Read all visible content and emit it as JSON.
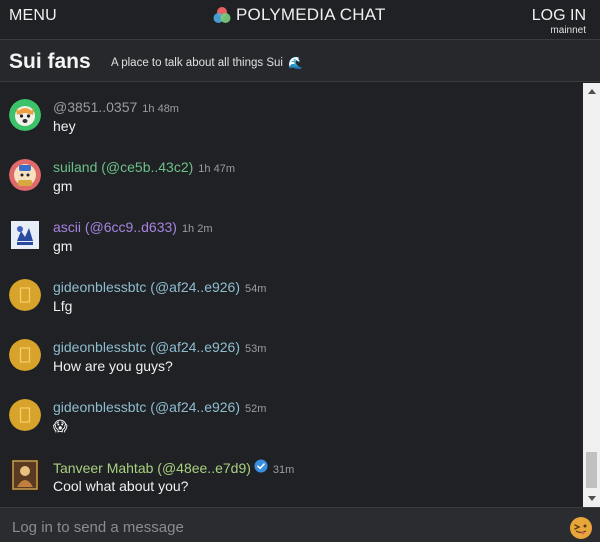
{
  "header": {
    "menu_label": "MENU",
    "app_title": "POLYMEDIA CHAT",
    "login_label": "LOG IN",
    "network": "mainnet"
  },
  "channel": {
    "name": "Sui fans",
    "description": "A place to talk about all things Sui",
    "description_icon": "water-wave-icon"
  },
  "colors": {
    "background": "#1f2124",
    "text": "#f0f0f0",
    "timestamp": "#9a9ca0",
    "author_gray": "#9a9ca0",
    "author_green": "#6cc08a",
    "author_purple": "#a784e0",
    "author_teal": "#8fbdd0",
    "author_lime": "#a8d080",
    "verified_blue": "#3a8ee0"
  },
  "messages": [
    {
      "author": "@3851..0357",
      "time": "1h 48m",
      "text": "hey",
      "avatar": "cat-avatar-icon"
    },
    {
      "author": "suiland (@ce5b..43c2)",
      "time": "1h 47m",
      "text": "gm",
      "avatar": "suiland-avatar-icon"
    },
    {
      "author": "ascii (@6cc9..d633)",
      "time": "1h 2m",
      "text": "gm",
      "avatar": "ascii-avatar-icon"
    },
    {
      "author": "gideonblessbtc (@af24..e926)",
      "time": "54m",
      "text": "Lfg",
      "avatar": "gold-coin-avatar-icon"
    },
    {
      "author": "gideonblessbtc (@af24..e926)",
      "time": "53m",
      "text": "How are you guys?",
      "avatar": "gold-coin-avatar-icon"
    },
    {
      "author": "gideonblessbtc (@af24..e926)",
      "time": "52m",
      "text": "😱",
      "avatar": "gold-coin-avatar-icon"
    },
    {
      "author": "Tanveer Mahtab (@48ee..e7d9)",
      "time": "31m",
      "text": "Cool what about you?",
      "avatar": "tanveer-avatar-icon",
      "verified": true
    }
  ],
  "composer": {
    "placeholder": "Log in to send a message",
    "emoji_icon": "tongue-out-emoji-icon"
  }
}
